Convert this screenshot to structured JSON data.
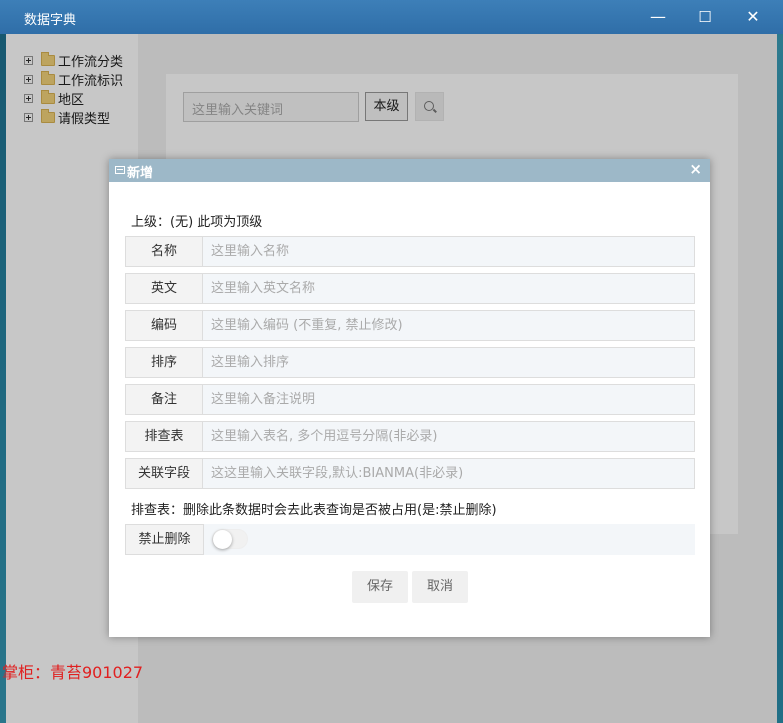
{
  "window": {
    "title": "数据字典",
    "minimize": "—",
    "maximize": "☐",
    "close": "✕"
  },
  "tree": {
    "items": [
      {
        "label": "工作流分类"
      },
      {
        "label": "工作流标识"
      },
      {
        "label": "地区"
      },
      {
        "label": "请假类型"
      }
    ]
  },
  "toolbar": {
    "search_placeholder": "这里输入关键词",
    "level_button": "本级"
  },
  "dialog": {
    "title": "新增",
    "close": "×",
    "parent_line": "上级：(无) 此项为顶级",
    "fields": [
      {
        "label": "名称",
        "placeholder": "这里输入名称"
      },
      {
        "label": "英文",
        "placeholder": "这里输入英文名称"
      },
      {
        "label": "编码",
        "placeholder": "这里输入编码 (不重复, 禁止修改)"
      },
      {
        "label": "排序",
        "placeholder": "这里输入排序"
      },
      {
        "label": "备注",
        "placeholder": "这里输入备注说明"
      },
      {
        "label": "排查表",
        "placeholder": "这里输入表名, 多个用逗号分隔(非必录)"
      },
      {
        "label": "关联字段",
        "placeholder": "这这里输入关联字段,默认:BIANMA(非必录)"
      }
    ],
    "hint": "排查表：删除此条数据时会去此表查询是否被占用(是:禁止删除)",
    "toggle_label": "禁止删除",
    "toggle_on": false,
    "save": "保存",
    "cancel": "取消"
  },
  "watermark": "掌柜：青苔901027"
}
